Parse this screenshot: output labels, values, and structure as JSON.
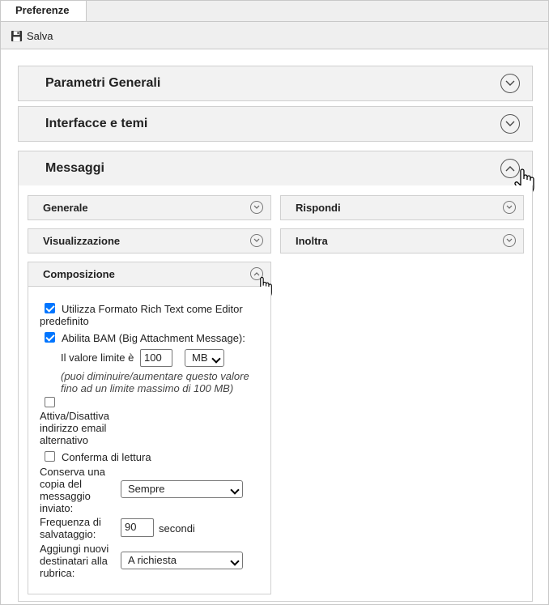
{
  "tab": {
    "label": "Preferenze"
  },
  "toolbar": {
    "save_label": "Salva"
  },
  "sections": {
    "parametri": {
      "title": "Parametri Generali"
    },
    "interfacce": {
      "title": "Interfacce e temi"
    },
    "messaggi": {
      "title": "Messaggi"
    }
  },
  "subsections": {
    "generale": "Generale",
    "rispondi": "Rispondi",
    "visualizzazione": "Visualizzazione",
    "inoltra": "Inoltra",
    "composizione": "Composizione"
  },
  "composizione": {
    "rich_text_label_1": "Utilizza Formato Rich Text come Editor",
    "rich_text_label_2": "predefinito",
    "rich_text_checked": true,
    "bam_label": "Abilita BAM (Big Attachment Message):",
    "bam_checked": true,
    "limit_label": "Il valore limite è",
    "limit_value": "100",
    "limit_unit": "MB",
    "note_1": "(puoi diminuire/aumentare questo valore",
    "note_2": "fino ad un limite massimo di 100 MB)",
    "alt_email_1": "Attiva/Disattiva",
    "alt_email_2": "indirizzo email",
    "alt_email_3": "alternativo",
    "alt_email_checked": false,
    "read_receipt_label": "Conferma di lettura",
    "read_receipt_checked": false,
    "keep_copy_1": "Conserva una",
    "keep_copy_2": "copia del",
    "keep_copy_3": "messaggio",
    "keep_copy_4": "inviato:",
    "keep_copy_value": "Sempre",
    "save_freq_1": "Frequenza di",
    "save_freq_2": "salvataggio:",
    "save_freq_value": "90",
    "save_freq_unit": "secondi",
    "add_rcpt_1": "Aggiungi nuovi",
    "add_rcpt_2": "destinatari alla",
    "add_rcpt_3": "rubrica:",
    "add_rcpt_value": "A richiesta"
  }
}
